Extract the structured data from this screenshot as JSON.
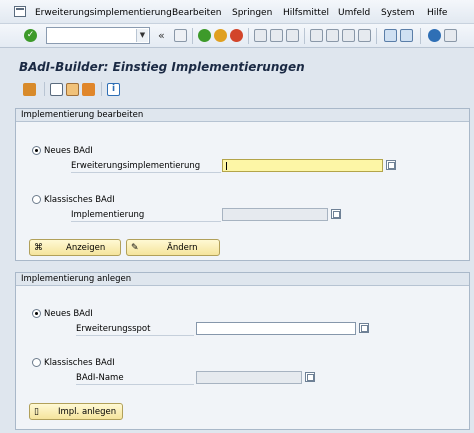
{
  "menu": {
    "items": [
      "Erweiterungsimplementierung",
      "Bearbeiten",
      "Springen",
      "Hilfsmittel",
      "Umfeld",
      "System",
      "Hilfe"
    ]
  },
  "toolbar": {
    "command_field_value": "",
    "history_label": "«",
    "icons": [
      "enter-icon",
      "save-icon",
      "back-icon",
      "exit-icon",
      "cancel-icon",
      "print-icon",
      "find-icon",
      "find-next-icon",
      "first-page-icon",
      "previous-page-icon",
      "next-page-icon",
      "last-page-icon",
      "new-session-icon",
      "shortcut-icon",
      "help-icon",
      "customize-layout-icon"
    ]
  },
  "title": "BAdI-Builder: Einstieg Implementierungen",
  "group_edit": {
    "header": "Implementierung bearbeiten",
    "radio_new": "Neues BAdI",
    "field_enh_impl": "Erweiterungsimplementierung",
    "field_enh_impl_value": "",
    "radio_classic": "Klassisches BAdI",
    "field_impl": "Implementierung",
    "field_impl_value": "",
    "btn_display": "Anzeigen",
    "btn_change": "Ändern"
  },
  "group_create": {
    "header": "Implementierung anlegen",
    "radio_new": "Neues BAdI",
    "field_enh_spot": "Erweiterungsspot",
    "field_enh_spot_value": "",
    "radio_classic": "Klassisches BAdI",
    "field_badi_name": "BAdI-Name",
    "field_badi_name_value": "",
    "btn_create": "Impl. anlegen"
  },
  "colors": {
    "background": "#dfe6ee",
    "active_field": "#fdf6a6",
    "button": "#f5e49c"
  }
}
